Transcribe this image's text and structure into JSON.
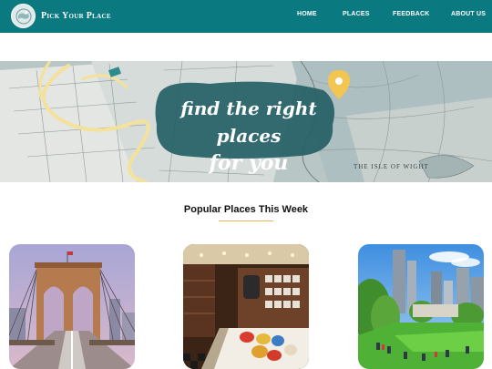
{
  "brand": {
    "name": "Pick Your Place"
  },
  "nav": {
    "home": "HOME",
    "places": "PLACES",
    "feedback": "FEEDBACK",
    "about": "ABOUT US"
  },
  "hero": {
    "line1": "find the right places",
    "line2": "for you",
    "map_label": "THE ISLE OF WIGHT"
  },
  "popular": {
    "title": "Popular Places This Week"
  },
  "colors": {
    "navbar": "#0a7a80",
    "accent_rule": "#e2b65a",
    "hero_badge": "#245f66"
  },
  "cards": [
    {
      "icon": "bridge-photo"
    },
    {
      "icon": "shop-interior-photo"
    },
    {
      "icon": "city-park-photo"
    }
  ]
}
